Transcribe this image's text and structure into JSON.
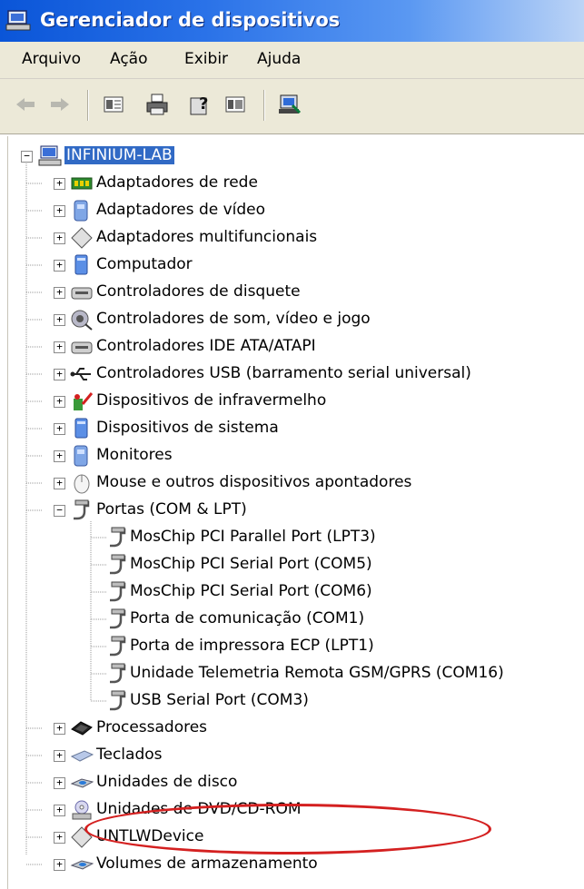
{
  "window": {
    "title": "Gerenciador de dispositivos"
  },
  "menu": {
    "items": [
      "Arquivo",
      "Ação",
      "Exibir",
      "Ajuda"
    ]
  },
  "toolbar": {
    "buttons": [
      "back-arrow-icon",
      "forward-arrow-icon",
      "properties-icon",
      "print-icon",
      "help-icon",
      "show-hide-console-tree-icon",
      "scan-hardware-icon"
    ]
  },
  "tree": {
    "root": {
      "label": "INFINIUM-LAB",
      "expanded": true,
      "selected": true
    },
    "categories": [
      {
        "label": "Adaptadores de rede",
        "icon": "network-adapter-icon",
        "expanded": false
      },
      {
        "label": "Adaptadores de vídeo",
        "icon": "display-adapter-icon",
        "expanded": false
      },
      {
        "label": "Adaptadores multifuncionais",
        "icon": "multifunction-adapter-icon",
        "expanded": false
      },
      {
        "label": "Computador",
        "icon": "computer-icon",
        "expanded": false
      },
      {
        "label": "Controladores de disquete",
        "icon": "floppy-controller-icon",
        "expanded": false
      },
      {
        "label": "Controladores de som, vídeo e jogo",
        "icon": "sound-controller-icon",
        "expanded": false
      },
      {
        "label": "Controladores IDE ATA/ATAPI",
        "icon": "ide-controller-icon",
        "expanded": false
      },
      {
        "label": "Controladores USB (barramento serial universal)",
        "icon": "usb-icon",
        "expanded": false
      },
      {
        "label": "Dispositivos de infravermelho",
        "icon": "infrared-icon",
        "expanded": false
      },
      {
        "label": "Dispositivos de sistema",
        "icon": "system-device-icon",
        "expanded": false
      },
      {
        "label": "Monitores",
        "icon": "monitor-icon",
        "expanded": false
      },
      {
        "label": "Mouse e outros dispositivos apontadores",
        "icon": "mouse-icon",
        "expanded": false
      },
      {
        "label": "Portas (COM & LPT)",
        "icon": "port-icon",
        "expanded": true
      }
    ],
    "port_children": [
      {
        "label": "MosChip PCI Parallel Port (LPT3)",
        "icon": "port-icon"
      },
      {
        "label": "MosChip PCI Serial Port (COM5)",
        "icon": "port-icon"
      },
      {
        "label": "MosChip PCI Serial Port (COM6)",
        "icon": "port-icon"
      },
      {
        "label": "Porta de comunicação (COM1)",
        "icon": "port-icon"
      },
      {
        "label": "Porta de impressora ECP (LPT1)",
        "icon": "port-icon"
      },
      {
        "label": "Unidade Telemetria Remota GSM/GPRS (COM16)",
        "icon": "port-icon",
        "highlighted": true
      },
      {
        "label": "USB Serial Port (COM3)",
        "icon": "port-icon"
      }
    ],
    "more_categories": [
      {
        "label": "Processadores",
        "icon": "processor-icon",
        "expanded": false
      },
      {
        "label": "Teclados",
        "icon": "keyboard-icon",
        "expanded": false
      },
      {
        "label": "Unidades de disco",
        "icon": "disk-drive-icon",
        "expanded": false
      },
      {
        "label": "Unidades de DVD/CD-ROM",
        "icon": "dvd-drive-icon",
        "expanded": false
      },
      {
        "label": "UNTLWDevice",
        "icon": "generic-device-icon",
        "expanded": false
      },
      {
        "label": "Volumes de armazenamento",
        "icon": "storage-volume-icon",
        "expanded": false
      }
    ]
  },
  "annotation": {
    "color": "#d42020"
  },
  "colors": {
    "selection": "#316ac5",
    "titlebar": "#0a55d8"
  }
}
